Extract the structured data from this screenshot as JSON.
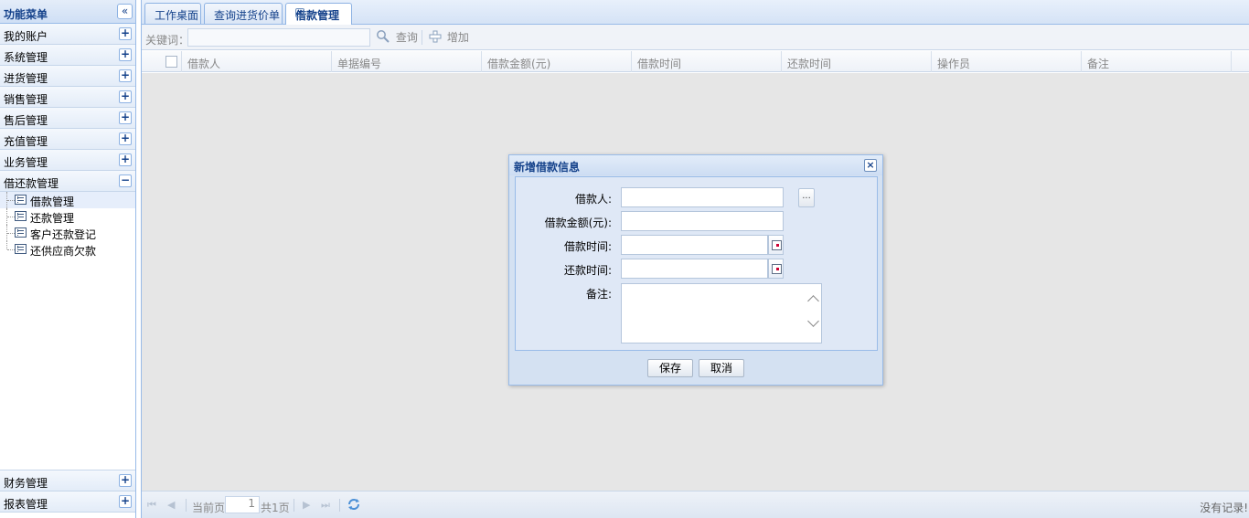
{
  "sidebar": {
    "title": "功能菜单",
    "collapse_glyph": "«",
    "sections": [
      {
        "label": "我的账户",
        "tool": "+"
      },
      {
        "label": "系统管理",
        "tool": "+"
      },
      {
        "label": "进货管理",
        "tool": "+"
      },
      {
        "label": "销售管理",
        "tool": "+"
      },
      {
        "label": "售后管理",
        "tool": "+"
      },
      {
        "label": "充值管理",
        "tool": "+"
      },
      {
        "label": "业务管理",
        "tool": "+"
      },
      {
        "label": "借还款管理",
        "tool": "−"
      }
    ],
    "sub_items": [
      {
        "label": "借款管理",
        "icon": "list-icon"
      },
      {
        "label": "还款管理",
        "icon": "list-icon"
      },
      {
        "label": "客户还款登记",
        "icon": "list-icon"
      },
      {
        "label": "还供应商欠款",
        "icon": "list-icon"
      }
    ],
    "bottom_sections": [
      {
        "label": "财务管理",
        "tool": "+"
      },
      {
        "label": "报表管理",
        "tool": "+"
      }
    ]
  },
  "tabs": [
    {
      "label": "工作桌面"
    },
    {
      "label": "查询进货价单"
    },
    {
      "label": "借款管理",
      "close": "×"
    }
  ],
  "toolbar": {
    "keyword_label": "关键词：",
    "search_label": "查询",
    "add_label": "增加"
  },
  "grid": {
    "columns": [
      "借款人",
      "单据编号",
      "借款金额(元)",
      "借款时间",
      "还款时间",
      "操作员",
      "备注"
    ]
  },
  "pager": {
    "current_label": "当前页",
    "page_value": "1",
    "total_label": "共1页",
    "status": "没有记录!"
  },
  "dialog": {
    "title": "新增借款信息",
    "close_glyph": "×",
    "fields": {
      "borrower": "借款人:",
      "amount": "借款金额(元):",
      "borrow_time": "借款时间:",
      "repay_time": "还款时间:",
      "remark": "备注:"
    },
    "pick_label": "...",
    "save_label": "保存",
    "cancel_label": "取消"
  },
  "colors": {
    "accent": "#15428b",
    "border": "#99bbe8",
    "grid_bg": "#e6e6e6",
    "dialog_bg": "#dfe8f6"
  }
}
